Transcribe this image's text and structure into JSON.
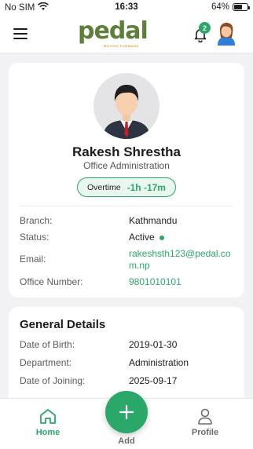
{
  "status_bar": {
    "carrier": "No SIM",
    "time": "16:33",
    "battery": "64%"
  },
  "header": {
    "logo_text": "pedal",
    "logo_tagline": "MOVING FORWARD",
    "notification_count": "2"
  },
  "profile": {
    "name": "Rakesh Shrestha",
    "role": "Office Administration",
    "overtime_label": "Overtime",
    "overtime_value": "-1h -17m",
    "rows": [
      {
        "label": "Branch:",
        "value": "Kathmandu"
      },
      {
        "label": "Status:",
        "value": "Active"
      },
      {
        "label": "Email:",
        "value": "rakeshsth123@pedal.com.np"
      },
      {
        "label": "Office Number:",
        "value": "9801010101"
      }
    ]
  },
  "general_details": {
    "title": "General Details",
    "rows": [
      {
        "label": "Date of Birth:",
        "value": "2019-01-30"
      },
      {
        "label": "Department:",
        "value": "Administration"
      },
      {
        "label": "Date of Joining:",
        "value": "2025-09-17"
      }
    ]
  },
  "bottom_nav": {
    "home_label": "Home",
    "add_label": "Add",
    "profile_label": "Profile"
  },
  "colors": {
    "accent": "#2aa86a",
    "logo_green": "#5d7f3a",
    "logo_orange": "#e0a030"
  }
}
